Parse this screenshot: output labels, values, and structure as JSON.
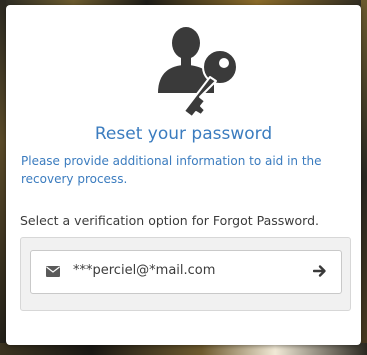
{
  "dialog": {
    "title": "Reset your password",
    "subtitle": "Please provide additional information to aid in the recovery process.",
    "instruction": "Select a verification option for Forgot Password.",
    "hero_icon": "user-key-icon",
    "accent_color": "#3b7cbf"
  },
  "options": [
    {
      "icon": "envelope-icon",
      "label": "***perciel@*mail.com",
      "action_icon": "arrow-right-icon"
    }
  ]
}
